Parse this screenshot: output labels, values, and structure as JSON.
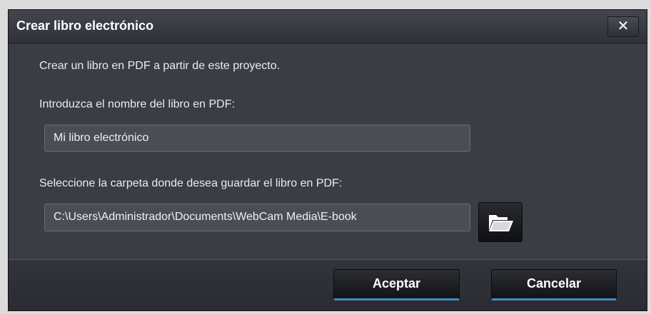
{
  "dialog": {
    "title": "Crear libro electrónico",
    "close_label": "✕",
    "description": "Crear un libro en PDF a partir de este proyecto.",
    "name_label": "Introduzca el nombre del libro en PDF:",
    "name_value": "Mi libro electrónico",
    "folder_label": "Seleccione la carpeta donde desea guardar el libro en PDF:",
    "folder_value": "C:\\Users\\Administrador\\Documents\\WebCam Media\\E-book",
    "accept_label": "Aceptar",
    "cancel_label": "Cancelar"
  },
  "colors": {
    "dialog_bg": "#3d3f47",
    "field_bg": "#4b4d55",
    "button_accent": "#3d8fc7"
  }
}
